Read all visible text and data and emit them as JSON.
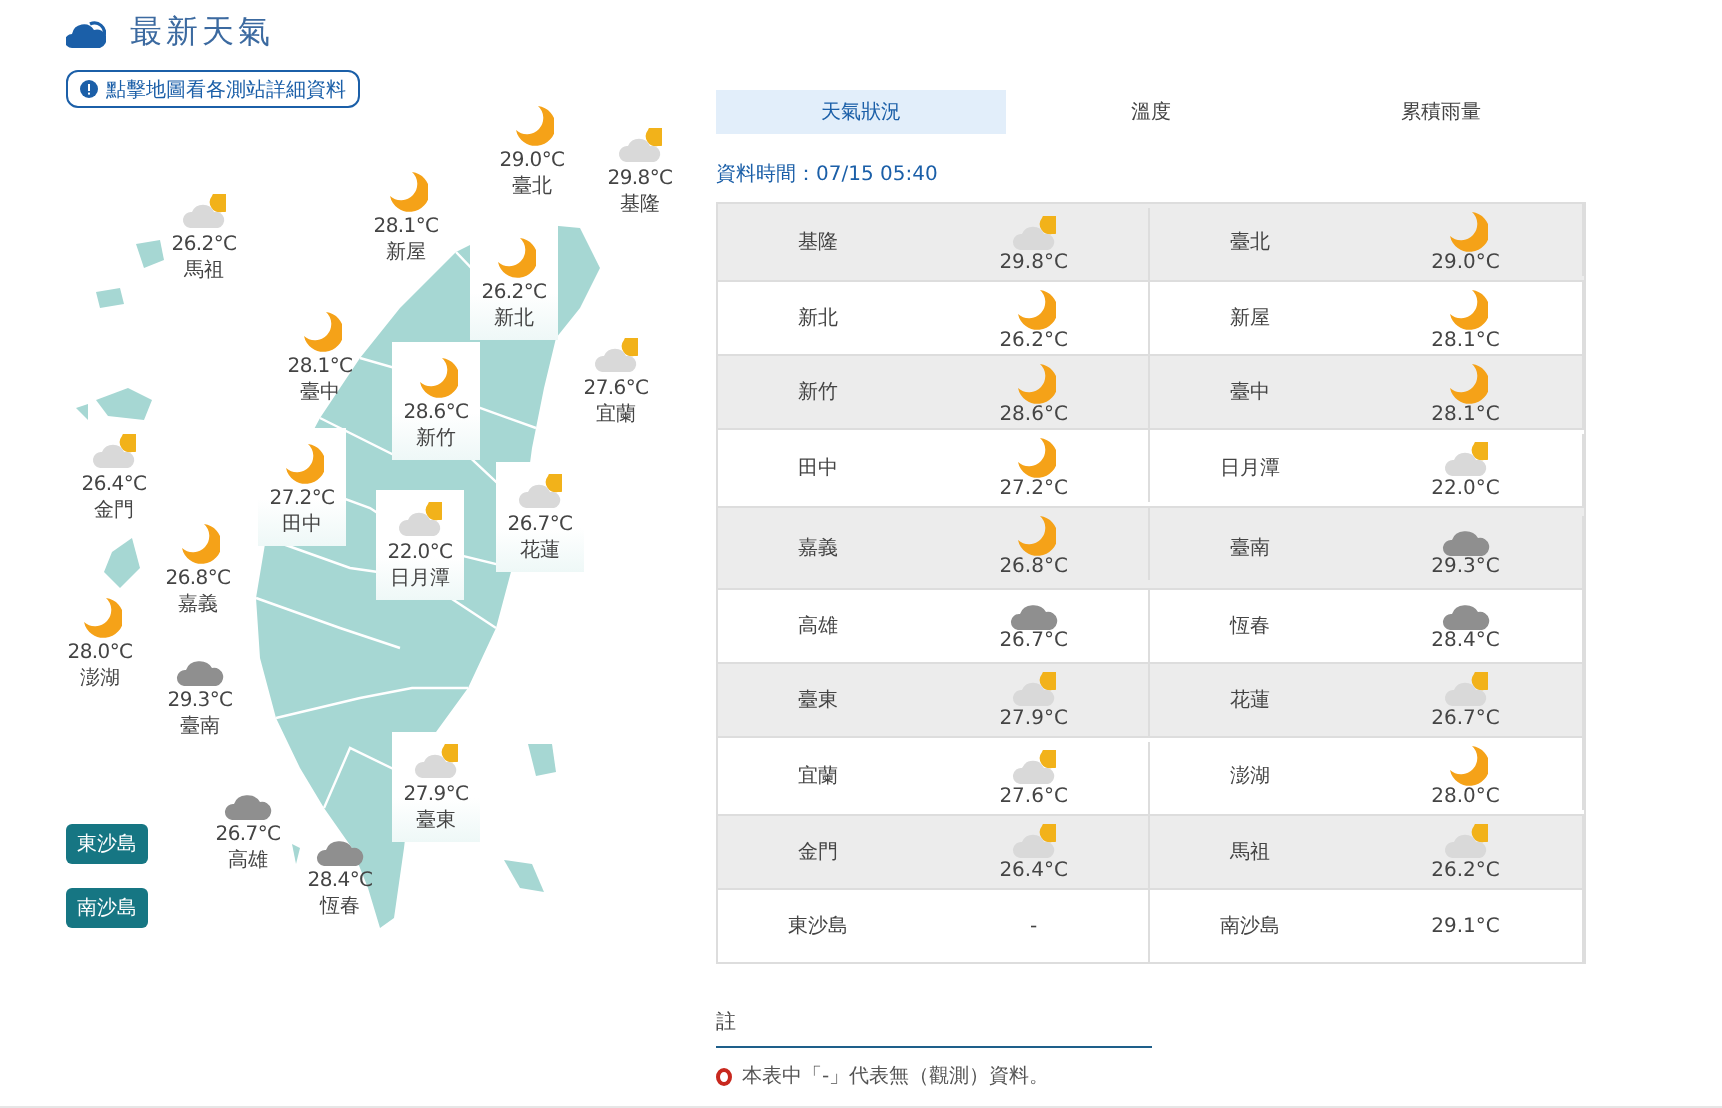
{
  "header": {
    "title": "最新天氣",
    "info_button": "點擊地圖看各測站詳細資料"
  },
  "map": {
    "stations": [
      {
        "name": "臺北",
        "temp": "29.0°C",
        "kind": "moon",
        "highlighted": false
      },
      {
        "name": "基隆",
        "temp": "29.8°C",
        "kind": "partly",
        "highlighted": false
      },
      {
        "name": "新屋",
        "temp": "28.1°C",
        "kind": "moon",
        "highlighted": false
      },
      {
        "name": "馬祖",
        "temp": "26.2°C",
        "kind": "partly",
        "highlighted": false
      },
      {
        "name": "新北",
        "temp": "26.2°C",
        "kind": "moon",
        "highlighted": true
      },
      {
        "name": "臺中",
        "temp": "28.1°C",
        "kind": "moon",
        "highlighted": false
      },
      {
        "name": "宜蘭",
        "temp": "27.6°C",
        "kind": "partly",
        "highlighted": false
      },
      {
        "name": "新竹",
        "temp": "28.6°C",
        "kind": "moon",
        "highlighted": true
      },
      {
        "name": "金門",
        "temp": "26.4°C",
        "kind": "partly",
        "highlighted": false
      },
      {
        "name": "田中",
        "temp": "27.2°C",
        "kind": "moon",
        "highlighted": true
      },
      {
        "name": "花蓮",
        "temp": "26.7°C",
        "kind": "partly",
        "highlighted": true
      },
      {
        "name": "嘉義",
        "temp": "26.8°C",
        "kind": "moon",
        "highlighted": false
      },
      {
        "name": "日月潭",
        "temp": "22.0°C",
        "kind": "partly",
        "highlighted": true
      },
      {
        "name": "澎湖",
        "temp": "28.0°C",
        "kind": "moon",
        "highlighted": false
      },
      {
        "name": "臺南",
        "temp": "29.3°C",
        "kind": "cloudy",
        "highlighted": false
      },
      {
        "name": "臺東",
        "temp": "27.9°C",
        "kind": "partly",
        "highlighted": true
      },
      {
        "name": "高雄",
        "temp": "26.7°C",
        "kind": "cloudy",
        "highlighted": false
      },
      {
        "name": "恆春",
        "temp": "28.4°C",
        "kind": "cloudy",
        "highlighted": false
      }
    ],
    "island_buttons": [
      "東沙島",
      "南沙島"
    ]
  },
  "tabs": [
    {
      "label": "天氣狀況",
      "selected": true
    },
    {
      "label": "溫度",
      "selected": false
    },
    {
      "label": "累積雨量",
      "selected": false
    }
  ],
  "data_time": "資料時間：07/15 05:40",
  "table": {
    "rows": [
      {
        "cells": [
          {
            "name": "基隆",
            "temp": "29.8°C",
            "kind": "partly"
          },
          {
            "name": "臺北",
            "temp": "29.0°C",
            "kind": "moon"
          }
        ]
      },
      {
        "cells": [
          {
            "name": "新北",
            "temp": "26.2°C",
            "kind": "moon"
          },
          {
            "name": "新屋",
            "temp": "28.1°C",
            "kind": "moon"
          }
        ]
      },
      {
        "cells": [
          {
            "name": "新竹",
            "temp": "28.6°C",
            "kind": "moon"
          },
          {
            "name": "臺中",
            "temp": "28.1°C",
            "kind": "moon"
          }
        ]
      },
      {
        "cells": [
          {
            "name": "田中",
            "temp": "27.2°C",
            "kind": "moon"
          },
          {
            "name": "日月潭",
            "temp": "22.0°C",
            "kind": "partly"
          }
        ]
      },
      {
        "cells": [
          {
            "name": "嘉義",
            "temp": "26.8°C",
            "kind": "moon"
          },
          {
            "name": "臺南",
            "temp": "29.3°C",
            "kind": "cloudy"
          }
        ]
      },
      {
        "cells": [
          {
            "name": "高雄",
            "temp": "26.7°C",
            "kind": "cloudy"
          },
          {
            "name": "恆春",
            "temp": "28.4°C",
            "kind": "cloudy"
          }
        ]
      },
      {
        "cells": [
          {
            "name": "臺東",
            "temp": "27.9°C",
            "kind": "partly"
          },
          {
            "name": "花蓮",
            "temp": "26.7°C",
            "kind": "partly"
          }
        ]
      },
      {
        "cells": [
          {
            "name": "宜蘭",
            "temp": "27.6°C",
            "kind": "partly"
          },
          {
            "name": "澎湖",
            "temp": "28.0°C",
            "kind": "moon"
          }
        ]
      },
      {
        "cells": [
          {
            "name": "金門",
            "temp": "26.4°C",
            "kind": "partly"
          },
          {
            "name": "馬祖",
            "temp": "26.2°C",
            "kind": "partly"
          }
        ]
      },
      {
        "cells": [
          {
            "name": "東沙島",
            "temp": "-"
          },
          {
            "name": "南沙島",
            "temp": "29.1°C"
          }
        ]
      }
    ]
  },
  "notes": {
    "title": "註",
    "items": [
      "本表中「-」代表無（觀測）資料。"
    ]
  }
}
